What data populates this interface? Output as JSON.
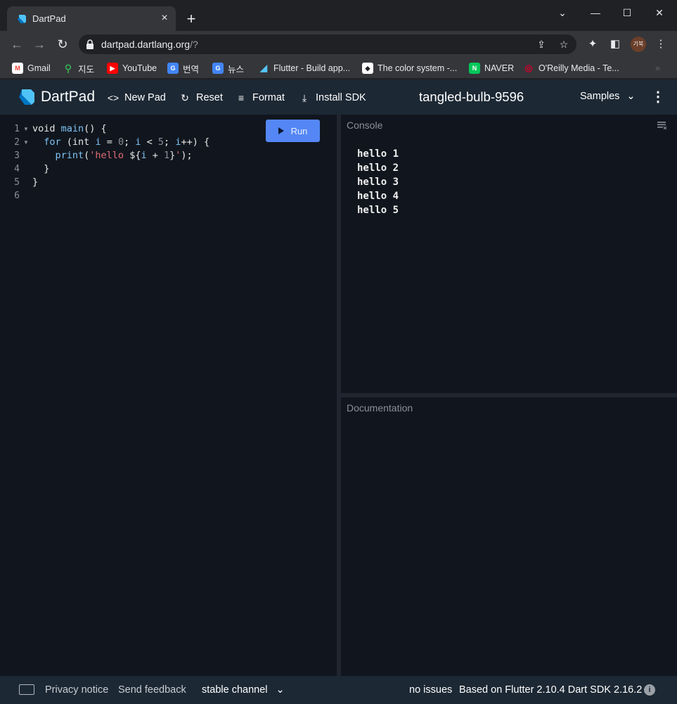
{
  "browser": {
    "tab_title": "DartPad",
    "url_host": "dartpad.dartlang.org",
    "url_path": "/?",
    "avatar_text": "기북",
    "bookmarks": [
      {
        "label": "Gmail",
        "icon": "gmail-icon",
        "color": "#ea4335"
      },
      {
        "label": "지도",
        "icon": "maps-icon",
        "color": "#34a853"
      },
      {
        "label": "YouTube",
        "icon": "youtube-icon",
        "color": "#ff0000"
      },
      {
        "label": "번역",
        "icon": "translate-icon",
        "color": "#4285f4"
      },
      {
        "label": "뉴스",
        "icon": "news-icon",
        "color": "#4285f4"
      },
      {
        "label": "Flutter - Build app...",
        "icon": "flutter-icon",
        "color": "#54c5f8"
      },
      {
        "label": "The color system -...",
        "icon": "material-icon",
        "color": "#ffffff"
      },
      {
        "label": "NAVER",
        "icon": "naver-icon",
        "color": "#03c75a"
      },
      {
        "label": "O'Reilly Media - Te...",
        "icon": "oreilly-icon",
        "color": "#d3002d"
      }
    ]
  },
  "dartpad": {
    "title": "DartPad",
    "actions": {
      "new_pad": "New Pad",
      "reset": "Reset",
      "format": "Format",
      "install_sdk": "Install SDK"
    },
    "pad_name": "tangled-bulb-9596",
    "samples": "Samples",
    "run_label": "Run"
  },
  "editor": {
    "line_numbers": [
      "1",
      "2",
      "3",
      "4",
      "5",
      "6"
    ],
    "lines": [
      "void main() {",
      "  for (int i = 0; i < 5; i++) {",
      "    print('hello ${i + 1}');",
      "  }",
      "}",
      ""
    ]
  },
  "console": {
    "title": "Console",
    "output": [
      "hello 1",
      "hello 2",
      "hello 3",
      "hello 4",
      "hello 5"
    ]
  },
  "documentation": {
    "title": "Documentation"
  },
  "footer": {
    "privacy": "Privacy notice",
    "feedback": "Send feedback",
    "channel": "stable channel",
    "issues": "no issues",
    "version": "Based on Flutter 2.10.4 Dart SDK 2.16.2"
  },
  "colors": {
    "run_button": "#5487f5",
    "header_bg": "#1c2834",
    "editor_bg": "#11161e"
  }
}
